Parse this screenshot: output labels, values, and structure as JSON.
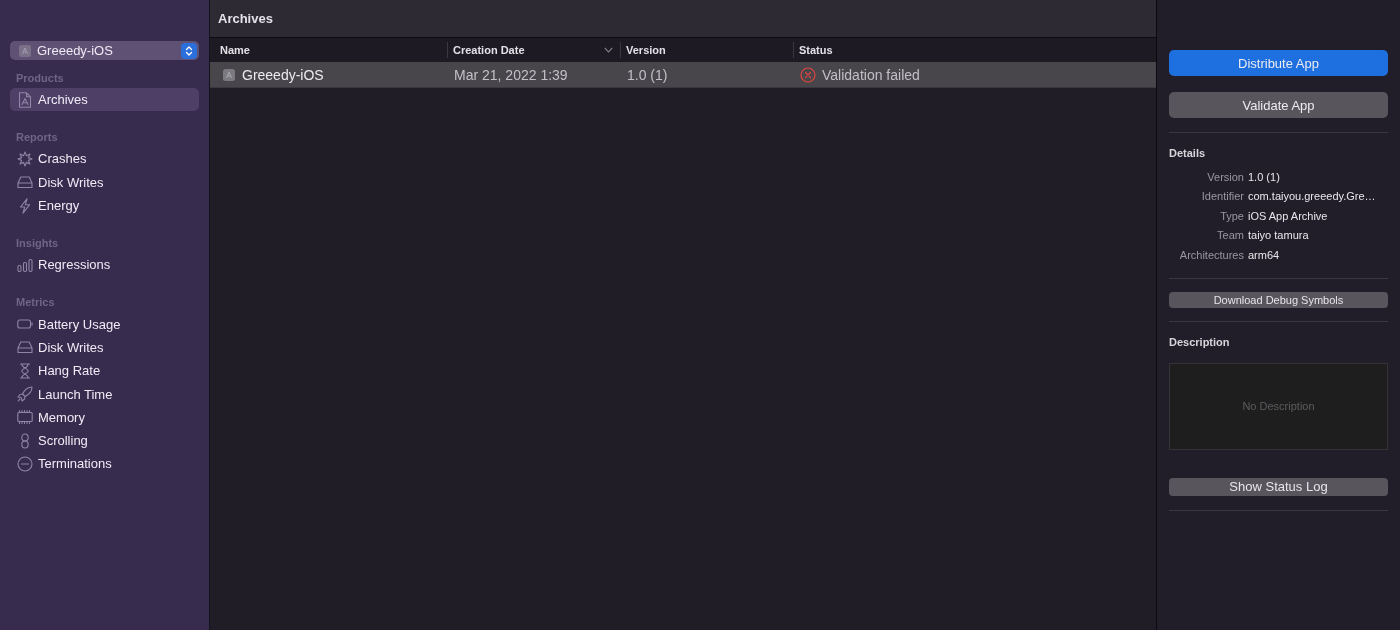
{
  "source_selector": {
    "label": "Greeedy-iOS"
  },
  "sidebar": {
    "sections": [
      {
        "title": "Products",
        "items": [
          {
            "label": "Archives",
            "selected": true
          }
        ]
      },
      {
        "title": "Reports",
        "items": [
          {
            "label": "Crashes",
            "selected": false
          },
          {
            "label": "Disk Writes",
            "selected": false
          },
          {
            "label": "Energy",
            "selected": false
          }
        ]
      },
      {
        "title": "Insights",
        "items": [
          {
            "label": "Regressions",
            "selected": false
          }
        ]
      },
      {
        "title": "Metrics",
        "items": [
          {
            "label": "Battery Usage",
            "selected": false
          },
          {
            "label": "Disk Writes",
            "selected": false
          },
          {
            "label": "Hang Rate",
            "selected": false
          },
          {
            "label": "Launch Time",
            "selected": false
          },
          {
            "label": "Memory",
            "selected": false
          },
          {
            "label": "Scrolling",
            "selected": false
          },
          {
            "label": "Terminations",
            "selected": false
          }
        ]
      }
    ]
  },
  "archives": {
    "title": "Archives",
    "columns": [
      {
        "label": "Name",
        "sorted": false
      },
      {
        "label": "Creation Date",
        "sorted": true
      },
      {
        "label": "Version",
        "sorted": false
      },
      {
        "label": "Status",
        "sorted": false
      }
    ],
    "rows": [
      {
        "name": "Greeedy-iOS",
        "creation_date": "Mar 21, 2022 1:39",
        "version": "1.0 (1)",
        "status": "Validation failed",
        "failed": true,
        "selected": true
      }
    ]
  },
  "inspector": {
    "buttons": [
      {
        "label": "Distribute App",
        "kind": "primary"
      },
      {
        "label": "Validate App",
        "kind": "secondary"
      }
    ],
    "details": {
      "title": "Details",
      "fields": [
        {
          "label": "Version",
          "value": "1.0 (1)"
        },
        {
          "label": "Identifier",
          "value": "com.taiyou.greeedy.Gre…"
        },
        {
          "label": "Type",
          "value": "iOS App Archive"
        },
        {
          "label": "Team",
          "value": "taiyo tamura"
        },
        {
          "label": "Architectures",
          "value": "arm64"
        }
      ]
    },
    "debug_symbols_button": {
      "label": "Download Debug Symbols"
    },
    "description": {
      "title": "Description",
      "placeholder": "No Description"
    },
    "status_log_button": {
      "label": "Show Status Log"
    }
  }
}
